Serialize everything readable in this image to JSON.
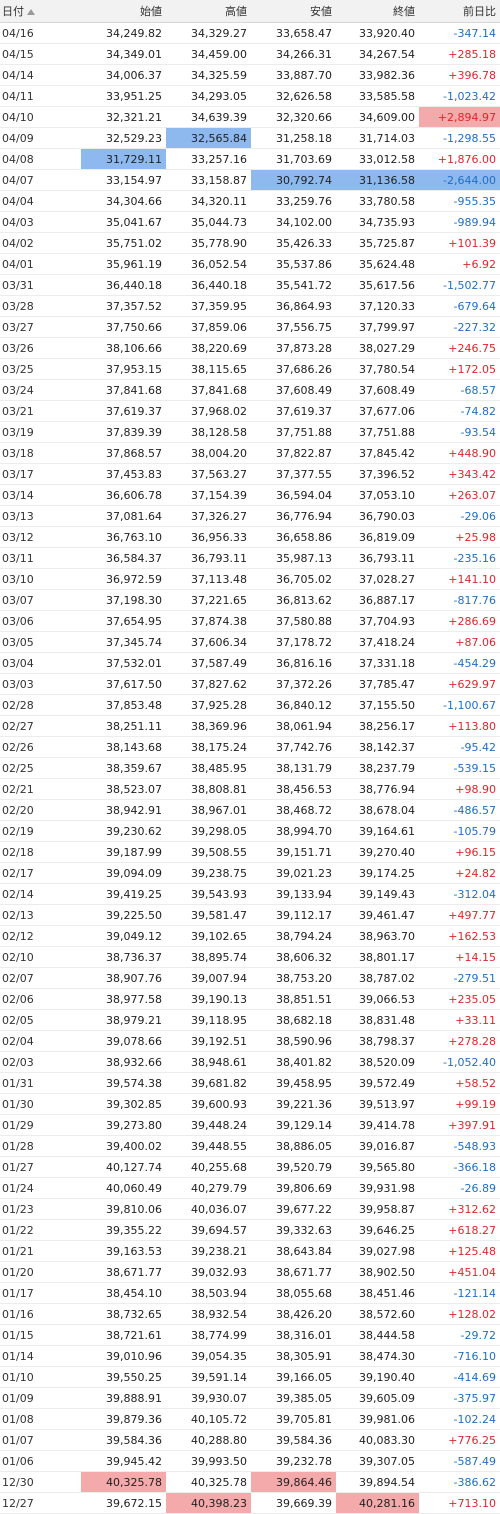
{
  "headers": {
    "date": "日付",
    "open": "始値",
    "high": "高値",
    "low": "安値",
    "close": "終値",
    "change": "前日比"
  },
  "sort_icon": "sort-ascending-icon",
  "colors": {
    "positive": "#e0262b",
    "negative": "#1f6fc5",
    "highlight_blue": "#8db9ee",
    "highlight_red": "#f4a9aa"
  },
  "rows": [
    {
      "date": "04/16",
      "open": "34,249.82",
      "high": "34,329.27",
      "low": "33,658.47",
      "close": "33,920.40",
      "change": "-347.14"
    },
    {
      "date": "04/15",
      "open": "34,349.01",
      "high": "34,459.00",
      "low": "34,266.31",
      "close": "34,267.54",
      "change": "+285.18"
    },
    {
      "date": "04/14",
      "open": "34,006.37",
      "high": "34,325.59",
      "low": "33,887.70",
      "close": "33,982.36",
      "change": "+396.78"
    },
    {
      "date": "04/11",
      "open": "33,951.25",
      "high": "34,293.05",
      "low": "32,626.58",
      "close": "33,585.58",
      "change": "-1,023.42"
    },
    {
      "date": "04/10",
      "open": "32,321.21",
      "high": "34,639.39",
      "low": "32,320.66",
      "close": "34,609.00",
      "change": "+2,894.97",
      "hl": {
        "change": "red"
      }
    },
    {
      "date": "04/09",
      "open": "32,529.23",
      "high": "32,565.84",
      "low": "31,258.18",
      "close": "31,714.03",
      "change": "-1,298.55",
      "hl": {
        "high": "blue"
      }
    },
    {
      "date": "04/08",
      "open": "31,729.11",
      "high": "33,257.16",
      "low": "31,703.69",
      "close": "33,012.58",
      "change": "+1,876.00",
      "hl": {
        "open": "blue"
      }
    },
    {
      "date": "04/07",
      "open": "33,154.97",
      "high": "33,158.87",
      "low": "30,792.74",
      "close": "31,136.58",
      "change": "-2,644.00",
      "hl": {
        "low": "blue",
        "close": "blue",
        "change": "blue"
      }
    },
    {
      "date": "04/04",
      "open": "34,304.66",
      "high": "34,320.11",
      "low": "33,259.76",
      "close": "33,780.58",
      "change": "-955.35"
    },
    {
      "date": "04/03",
      "open": "35,041.67",
      "high": "35,044.73",
      "low": "34,102.00",
      "close": "34,735.93",
      "change": "-989.94"
    },
    {
      "date": "04/02",
      "open": "35,751.02",
      "high": "35,778.90",
      "low": "35,426.33",
      "close": "35,725.87",
      "change": "+101.39"
    },
    {
      "date": "04/01",
      "open": "35,961.19",
      "high": "36,052.54",
      "low": "35,537.86",
      "close": "35,624.48",
      "change": "+6.92"
    },
    {
      "date": "03/31",
      "open": "36,440.18",
      "high": "36,440.18",
      "low": "35,541.72",
      "close": "35,617.56",
      "change": "-1,502.77"
    },
    {
      "date": "03/28",
      "open": "37,357.52",
      "high": "37,359.95",
      "low": "36,864.93",
      "close": "37,120.33",
      "change": "-679.64"
    },
    {
      "date": "03/27",
      "open": "37,750.66",
      "high": "37,859.06",
      "low": "37,556.75",
      "close": "37,799.97",
      "change": "-227.32"
    },
    {
      "date": "03/26",
      "open": "38,106.66",
      "high": "38,220.69",
      "low": "37,873.28",
      "close": "38,027.29",
      "change": "+246.75"
    },
    {
      "date": "03/25",
      "open": "37,953.15",
      "high": "38,115.65",
      "low": "37,686.26",
      "close": "37,780.54",
      "change": "+172.05"
    },
    {
      "date": "03/24",
      "open": "37,841.68",
      "high": "37,841.68",
      "low": "37,608.49",
      "close": "37,608.49",
      "change": "-68.57"
    },
    {
      "date": "03/21",
      "open": "37,619.37",
      "high": "37,968.02",
      "low": "37,619.37",
      "close": "37,677.06",
      "change": "-74.82"
    },
    {
      "date": "03/19",
      "open": "37,839.39",
      "high": "38,128.58",
      "low": "37,751.88",
      "close": "37,751.88",
      "change": "-93.54"
    },
    {
      "date": "03/18",
      "open": "37,868.57",
      "high": "38,004.20",
      "low": "37,822.87",
      "close": "37,845.42",
      "change": "+448.90"
    },
    {
      "date": "03/17",
      "open": "37,453.83",
      "high": "37,563.27",
      "low": "37,377.55",
      "close": "37,396.52",
      "change": "+343.42"
    },
    {
      "date": "03/14",
      "open": "36,606.78",
      "high": "37,154.39",
      "low": "36,594.04",
      "close": "37,053.10",
      "change": "+263.07"
    },
    {
      "date": "03/13",
      "open": "37,081.64",
      "high": "37,326.27",
      "low": "36,776.94",
      "close": "36,790.03",
      "change": "-29.06"
    },
    {
      "date": "03/12",
      "open": "36,763.10",
      "high": "36,956.33",
      "low": "36,658.86",
      "close": "36,819.09",
      "change": "+25.98"
    },
    {
      "date": "03/11",
      "open": "36,584.37",
      "high": "36,793.11",
      "low": "35,987.13",
      "close": "36,793.11",
      "change": "-235.16"
    },
    {
      "date": "03/10",
      "open": "36,972.59",
      "high": "37,113.48",
      "low": "36,705.02",
      "close": "37,028.27",
      "change": "+141.10"
    },
    {
      "date": "03/07",
      "open": "37,198.30",
      "high": "37,221.65",
      "low": "36,813.62",
      "close": "36,887.17",
      "change": "-817.76"
    },
    {
      "date": "03/06",
      "open": "37,654.95",
      "high": "37,874.38",
      "low": "37,580.88",
      "close": "37,704.93",
      "change": "+286.69"
    },
    {
      "date": "03/05",
      "open": "37,345.74",
      "high": "37,606.34",
      "low": "37,178.72",
      "close": "37,418.24",
      "change": "+87.06"
    },
    {
      "date": "03/04",
      "open": "37,532.01",
      "high": "37,587.49",
      "low": "36,816.16",
      "close": "37,331.18",
      "change": "-454.29"
    },
    {
      "date": "03/03",
      "open": "37,617.50",
      "high": "37,827.62",
      "low": "37,372.26",
      "close": "37,785.47",
      "change": "+629.97"
    },
    {
      "date": "02/28",
      "open": "37,853.48",
      "high": "37,925.28",
      "low": "36,840.12",
      "close": "37,155.50",
      "change": "-1,100.67"
    },
    {
      "date": "02/27",
      "open": "38,251.11",
      "high": "38,369.96",
      "low": "38,061.94",
      "close": "38,256.17",
      "change": "+113.80"
    },
    {
      "date": "02/26",
      "open": "38,143.68",
      "high": "38,175.24",
      "low": "37,742.76",
      "close": "38,142.37",
      "change": "-95.42"
    },
    {
      "date": "02/25",
      "open": "38,359.67",
      "high": "38,485.95",
      "low": "38,131.79",
      "close": "38,237.79",
      "change": "-539.15"
    },
    {
      "date": "02/21",
      "open": "38,523.07",
      "high": "38,808.81",
      "low": "38,456.53",
      "close": "38,776.94",
      "change": "+98.90"
    },
    {
      "date": "02/20",
      "open": "38,942.91",
      "high": "38,967.01",
      "low": "38,468.72",
      "close": "38,678.04",
      "change": "-486.57"
    },
    {
      "date": "02/19",
      "open": "39,230.62",
      "high": "39,298.05",
      "low": "38,994.70",
      "close": "39,164.61",
      "change": "-105.79"
    },
    {
      "date": "02/18",
      "open": "39,187.99",
      "high": "39,508.55",
      "low": "39,151.71",
      "close": "39,270.40",
      "change": "+96.15"
    },
    {
      "date": "02/17",
      "open": "39,094.09",
      "high": "39,238.75",
      "low": "39,021.23",
      "close": "39,174.25",
      "change": "+24.82"
    },
    {
      "date": "02/14",
      "open": "39,419.25",
      "high": "39,543.93",
      "low": "39,133.94",
      "close": "39,149.43",
      "change": "-312.04"
    },
    {
      "date": "02/13",
      "open": "39,225.50",
      "high": "39,581.47",
      "low": "39,112.17",
      "close": "39,461.47",
      "change": "+497.77"
    },
    {
      "date": "02/12",
      "open": "39,049.12",
      "high": "39,102.65",
      "low": "38,794.24",
      "close": "38,963.70",
      "change": "+162.53"
    },
    {
      "date": "02/10",
      "open": "38,736.37",
      "high": "38,895.74",
      "low": "38,606.32",
      "close": "38,801.17",
      "change": "+14.15"
    },
    {
      "date": "02/07",
      "open": "38,907.76",
      "high": "39,007.94",
      "low": "38,753.20",
      "close": "38,787.02",
      "change": "-279.51"
    },
    {
      "date": "02/06",
      "open": "38,977.58",
      "high": "39,190.13",
      "low": "38,851.51",
      "close": "39,066.53",
      "change": "+235.05"
    },
    {
      "date": "02/05",
      "open": "38,979.21",
      "high": "39,118.95",
      "low": "38,682.18",
      "close": "38,831.48",
      "change": "+33.11"
    },
    {
      "date": "02/04",
      "open": "39,078.66",
      "high": "39,192.51",
      "low": "38,590.96",
      "close": "38,798.37",
      "change": "+278.28"
    },
    {
      "date": "02/03",
      "open": "38,932.66",
      "high": "38,948.61",
      "low": "38,401.82",
      "close": "38,520.09",
      "change": "-1,052.40"
    },
    {
      "date": "01/31",
      "open": "39,574.38",
      "high": "39,681.82",
      "low": "39,458.95",
      "close": "39,572.49",
      "change": "+58.52"
    },
    {
      "date": "01/30",
      "open": "39,302.85",
      "high": "39,600.93",
      "low": "39,221.36",
      "close": "39,513.97",
      "change": "+99.19"
    },
    {
      "date": "01/29",
      "open": "39,273.80",
      "high": "39,448.24",
      "low": "39,129.14",
      "close": "39,414.78",
      "change": "+397.91"
    },
    {
      "date": "01/28",
      "open": "39,400.02",
      "high": "39,448.55",
      "low": "38,886.05",
      "close": "39,016.87",
      "change": "-548.93"
    },
    {
      "date": "01/27",
      "open": "40,127.74",
      "high": "40,255.68",
      "low": "39,520.79",
      "close": "39,565.80",
      "change": "-366.18"
    },
    {
      "date": "01/24",
      "open": "40,060.49",
      "high": "40,279.79",
      "low": "39,806.69",
      "close": "39,931.98",
      "change": "-26.89"
    },
    {
      "date": "01/23",
      "open": "39,810.06",
      "high": "40,036.07",
      "low": "39,677.22",
      "close": "39,958.87",
      "change": "+312.62"
    },
    {
      "date": "01/22",
      "open": "39,355.22",
      "high": "39,694.57",
      "low": "39,332.63",
      "close": "39,646.25",
      "change": "+618.27"
    },
    {
      "date": "01/21",
      "open": "39,163.53",
      "high": "39,238.21",
      "low": "38,643.84",
      "close": "39,027.98",
      "change": "+125.48"
    },
    {
      "date": "01/20",
      "open": "38,671.77",
      "high": "39,032.93",
      "low": "38,671.77",
      "close": "38,902.50",
      "change": "+451.04"
    },
    {
      "date": "01/17",
      "open": "38,454.10",
      "high": "38,503.94",
      "low": "38,055.68",
      "close": "38,451.46",
      "change": "-121.14"
    },
    {
      "date": "01/16",
      "open": "38,732.65",
      "high": "38,932.54",
      "low": "38,426.20",
      "close": "38,572.60",
      "change": "+128.02"
    },
    {
      "date": "01/15",
      "open": "38,721.61",
      "high": "38,774.99",
      "low": "38,316.01",
      "close": "38,444.58",
      "change": "-29.72"
    },
    {
      "date": "01/14",
      "open": "39,010.96",
      "high": "39,054.35",
      "low": "38,305.91",
      "close": "38,474.30",
      "change": "-716.10"
    },
    {
      "date": "01/10",
      "open": "39,550.25",
      "high": "39,591.14",
      "low": "39,166.05",
      "close": "39,190.40",
      "change": "-414.69"
    },
    {
      "date": "01/09",
      "open": "39,888.91",
      "high": "39,930.07",
      "low": "39,385.05",
      "close": "39,605.09",
      "change": "-375.97"
    },
    {
      "date": "01/08",
      "open": "39,879.36",
      "high": "40,105.72",
      "low": "39,705.81",
      "close": "39,981.06",
      "change": "-102.24"
    },
    {
      "date": "01/07",
      "open": "39,584.36",
      "high": "40,288.80",
      "low": "39,584.36",
      "close": "40,083.30",
      "change": "+776.25"
    },
    {
      "date": "01/06",
      "open": "39,945.42",
      "high": "39,993.50",
      "low": "39,232.78",
      "close": "39,307.05",
      "change": "-587.49"
    },
    {
      "date": "12/30",
      "open": "40,325.78",
      "high": "40,325.78",
      "low": "39,864.46",
      "close": "39,894.54",
      "change": "-386.62",
      "hl": {
        "open": "red",
        "low": "red"
      }
    },
    {
      "date": "12/27",
      "open": "39,672.15",
      "high": "40,398.23",
      "low": "39,669.39",
      "close": "40,281.16",
      "change": "+713.10",
      "hl": {
        "high": "red",
        "close": "red"
      }
    }
  ]
}
